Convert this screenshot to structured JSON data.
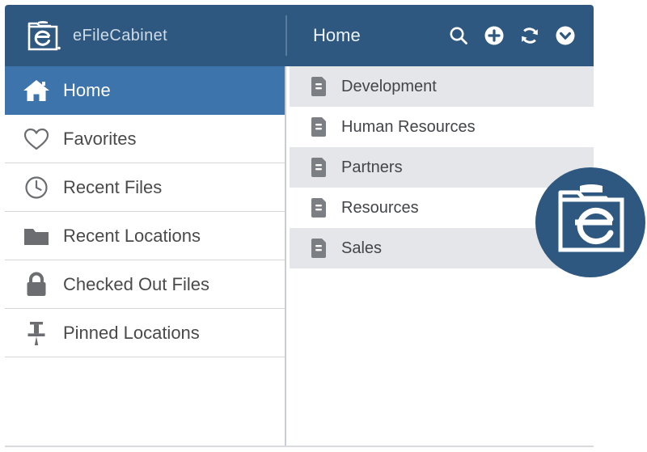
{
  "brand": {
    "name": "eFileCabinet",
    "logo_icon": "efilecabinet-folder-e-logo",
    "primary_color": "#2e5880",
    "accent_color": "#3d74ab"
  },
  "topbar": {
    "section_title": "Home",
    "actions": [
      {
        "name": "search",
        "icon": "search-icon",
        "label": "Search"
      },
      {
        "name": "add",
        "icon": "plus-circle-icon",
        "label": "Add"
      },
      {
        "name": "refresh",
        "icon": "refresh-icon",
        "label": "Refresh"
      },
      {
        "name": "more",
        "icon": "chevron-down-circle-icon",
        "label": "More"
      }
    ]
  },
  "sidebar": {
    "items": [
      {
        "label": "Home",
        "icon": "home-icon",
        "active": true
      },
      {
        "label": "Favorites",
        "icon": "heart-icon",
        "active": false
      },
      {
        "label": "Recent Files",
        "icon": "clock-icon",
        "active": false
      },
      {
        "label": "Recent Locations",
        "icon": "folder-icon",
        "active": false
      },
      {
        "label": "Checked Out Files",
        "icon": "lock-icon",
        "active": false
      },
      {
        "label": "Pinned Locations",
        "icon": "pushpin-icon",
        "active": false
      }
    ]
  },
  "content": {
    "rows": [
      {
        "label": "Development",
        "icon": "cabinet-icon",
        "shaded": true
      },
      {
        "label": "Human Resources",
        "icon": "cabinet-icon",
        "shaded": false
      },
      {
        "label": "Partners",
        "icon": "cabinet-icon",
        "shaded": true
      },
      {
        "label": "Resources",
        "icon": "cabinet-icon",
        "shaded": false
      },
      {
        "label": "Sales",
        "icon": "cabinet-icon",
        "shaded": true
      }
    ]
  },
  "watermark": {
    "icon": "efilecabinet-circle-logo",
    "color": "#2e5880"
  }
}
